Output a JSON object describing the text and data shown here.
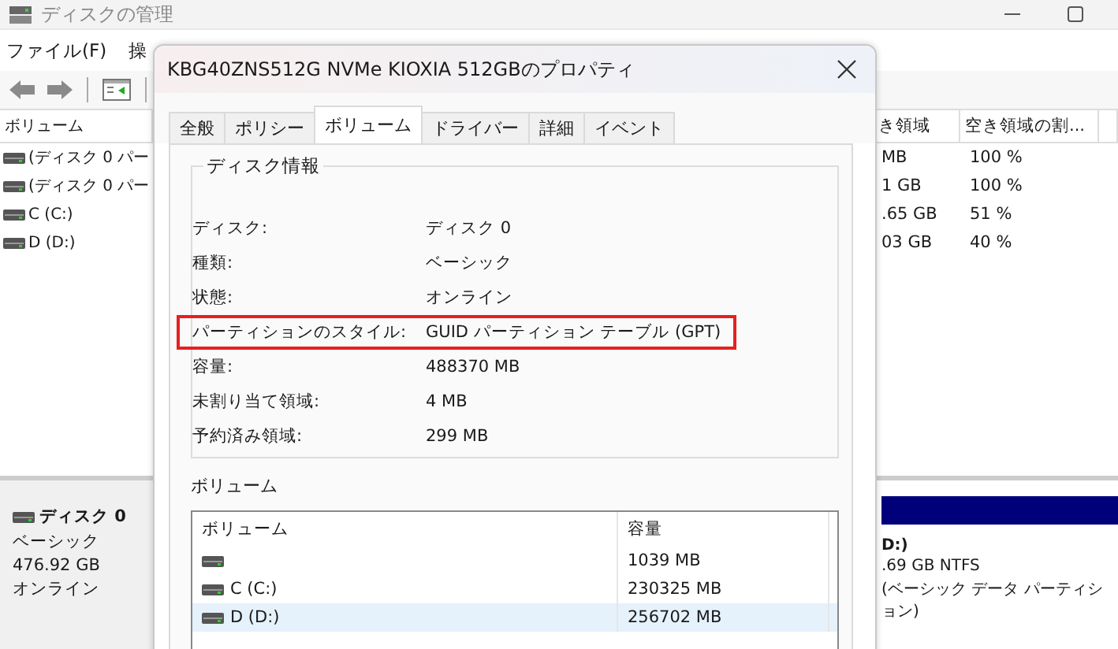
{
  "window": {
    "title": "ディスクの管理"
  },
  "menu": [
    "ファイル(F)",
    "操"
  ],
  "volume_list": {
    "columns": [
      "ボリューム",
      "き領域",
      "空き領域の割..."
    ],
    "rows": [
      {
        "name": "(ディスク 0 パー",
        "free": "MB",
        "percent": "100 %"
      },
      {
        "name": "(ディスク 0 パー",
        "free": "1 GB",
        "percent": "100 %"
      },
      {
        "name": "C (C:)",
        "free": ".65 GB",
        "percent": "51 %"
      },
      {
        "name": "D (D:)",
        "free": "03 GB",
        "percent": "40 %"
      }
    ]
  },
  "disk_pane": {
    "disk": {
      "name": "ディスク 0",
      "type": "ベーシック",
      "size": "476.92 GB",
      "status": "オンライン"
    },
    "partition": {
      "name": "D:)",
      "size": ".69 GB NTFS",
      "status": "(ベーシック データ パーティション)"
    }
  },
  "dialog": {
    "title": "KBG40ZNS512G NVMe KIOXIA 512GBのプロパティ",
    "tabs": [
      {
        "label": "全般",
        "selected": false
      },
      {
        "label": "ポリシー",
        "selected": false
      },
      {
        "label": "ボリューム",
        "selected": true
      },
      {
        "label": "ドライバー",
        "selected": false
      },
      {
        "label": "詳細",
        "selected": false
      },
      {
        "label": "イベント",
        "selected": false
      }
    ],
    "disk_info": {
      "title": "ディスク情報",
      "fields": [
        {
          "label": "ディスク:",
          "value": "ディスク 0",
          "highlighted": false
        },
        {
          "label": "種類:",
          "value": "ベーシック",
          "highlighted": false
        },
        {
          "label": "状態:",
          "value": "オンライン",
          "highlighted": false
        },
        {
          "label": "パーティションのスタイル:",
          "value": "GUID パーティション テーブル (GPT)",
          "highlighted": true
        },
        {
          "label": "容量:",
          "value": "488370 MB",
          "highlighted": false
        },
        {
          "label": "未割り当て領域:",
          "value": "4 MB",
          "highlighted": false
        },
        {
          "label": "予約済み領域:",
          "value": "299 MB",
          "highlighted": false
        }
      ]
    },
    "volumes": {
      "title": "ボリューム",
      "columns": [
        "ボリューム",
        "容量"
      ],
      "rows": [
        {
          "capacity": "1039 MB",
          "selected": false
        },
        {
          "name": "C (C:)",
          "capacity": "230325 MB",
          "selected": false
        },
        {
          "name": "D (D:)",
          "capacity": "256702 MB",
          "selected": true
        }
      ]
    }
  }
}
